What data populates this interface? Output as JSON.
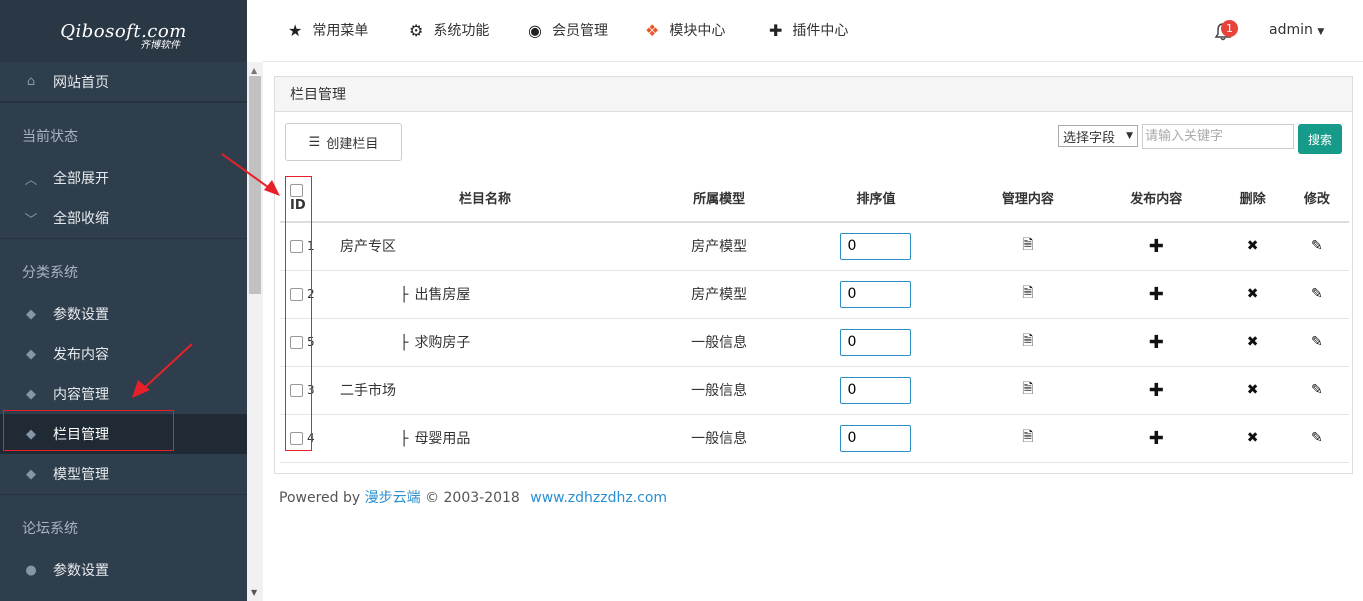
{
  "logo": {
    "brand": "Qibosoft",
    "suffix": ".com",
    "subtitle": "齐博软件"
  },
  "sidebar": {
    "home": "网站首页",
    "sections": [
      {
        "title": "当前状态",
        "items": [
          "全部展开",
          "全部收缩"
        ]
      },
      {
        "title": "分类系统",
        "items": [
          "参数设置",
          "发布内容",
          "内容管理",
          "栏目管理",
          "模型管理"
        ]
      },
      {
        "title": "论坛系统",
        "items": [
          "参数设置"
        ]
      }
    ],
    "active": "栏目管理"
  },
  "topnav": {
    "items": [
      "常用菜单",
      "系统功能",
      "会员管理",
      "模块中心",
      "插件中心"
    ],
    "notification_count": "1",
    "user": "admin"
  },
  "panel": {
    "title": "栏目管理",
    "create_button": "创建栏目",
    "select_field": "选择字段",
    "keyword_placeholder": "请输入关键字",
    "search_button": "搜索",
    "columns": [
      "ID",
      "栏目名称",
      "所属模型",
      "排序值",
      "管理内容",
      "发布内容",
      "删除",
      "修改"
    ],
    "rows": [
      {
        "id": "1",
        "name": "房产专区",
        "level": 0,
        "model": "房产模型",
        "sort": "0"
      },
      {
        "id": "2",
        "name": "出售房屋",
        "level": 1,
        "model": "房产模型",
        "sort": "0"
      },
      {
        "id": "5",
        "name": "求购房子",
        "level": 1,
        "model": "一般信息",
        "sort": "0"
      },
      {
        "id": "3",
        "name": "二手市场",
        "level": 0,
        "model": "一般信息",
        "sort": "0"
      },
      {
        "id": "4",
        "name": "母婴用品",
        "level": 1,
        "model": "一般信息",
        "sort": "0"
      }
    ]
  },
  "footer": {
    "powered": "Powered by",
    "brand": "漫步云端",
    "copyright": "© 2003-2018",
    "site": "www.zdhzzdhz.com"
  },
  "colors": {
    "sidebar": "#2f3e4c",
    "accent": "#169a8a",
    "highlight": "#e8202a",
    "link": "#2b8fd0"
  }
}
